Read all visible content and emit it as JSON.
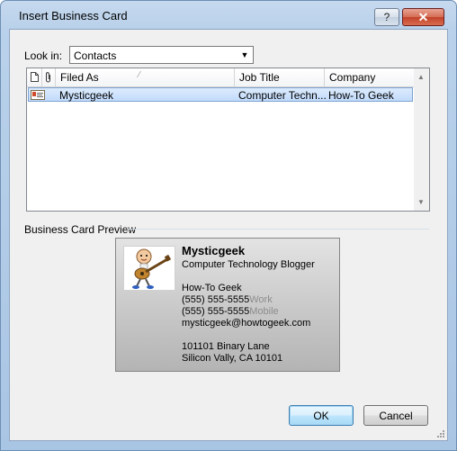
{
  "window": {
    "title": "Insert Business Card"
  },
  "titlebar": {
    "help_label": "?",
    "close_label": "✕"
  },
  "look_in": {
    "label": "Look in:",
    "value": "Contacts"
  },
  "list": {
    "columns": [
      "Filed As",
      "Job Title",
      "Company"
    ],
    "rows": [
      {
        "filed_as": "Mysticgeek",
        "job_title": "Computer Techn...",
        "company": "How-To Geek",
        "selected": true
      }
    ]
  },
  "preview": {
    "label": "Business Card Preview",
    "card": {
      "name": "Mysticgeek",
      "title": "Computer Technology Blogger",
      "company": "How-To Geek",
      "phone_work": "(555) 555-5555",
      "phone_work_label": "Work",
      "phone_mobile": "(555) 555-5555",
      "phone_mobile_label": "Mobile",
      "email": "mysticgeek@howtogeek.com",
      "address_line1": "101101 Binary Lane",
      "address_line2": "Silicon Vally, CA  10101"
    }
  },
  "buttons": {
    "ok": "OK",
    "cancel": "Cancel"
  },
  "colors": {
    "selection": "#c1dbfc",
    "selection_border": "#7da2ce",
    "frame": "#b9d1ea",
    "close_button": "#c2412a"
  },
  "icons": {
    "contact_card": "contact-card-icon",
    "document": "document-icon",
    "attachment": "attachment-icon",
    "avatar": "guitar-player-avatar"
  }
}
